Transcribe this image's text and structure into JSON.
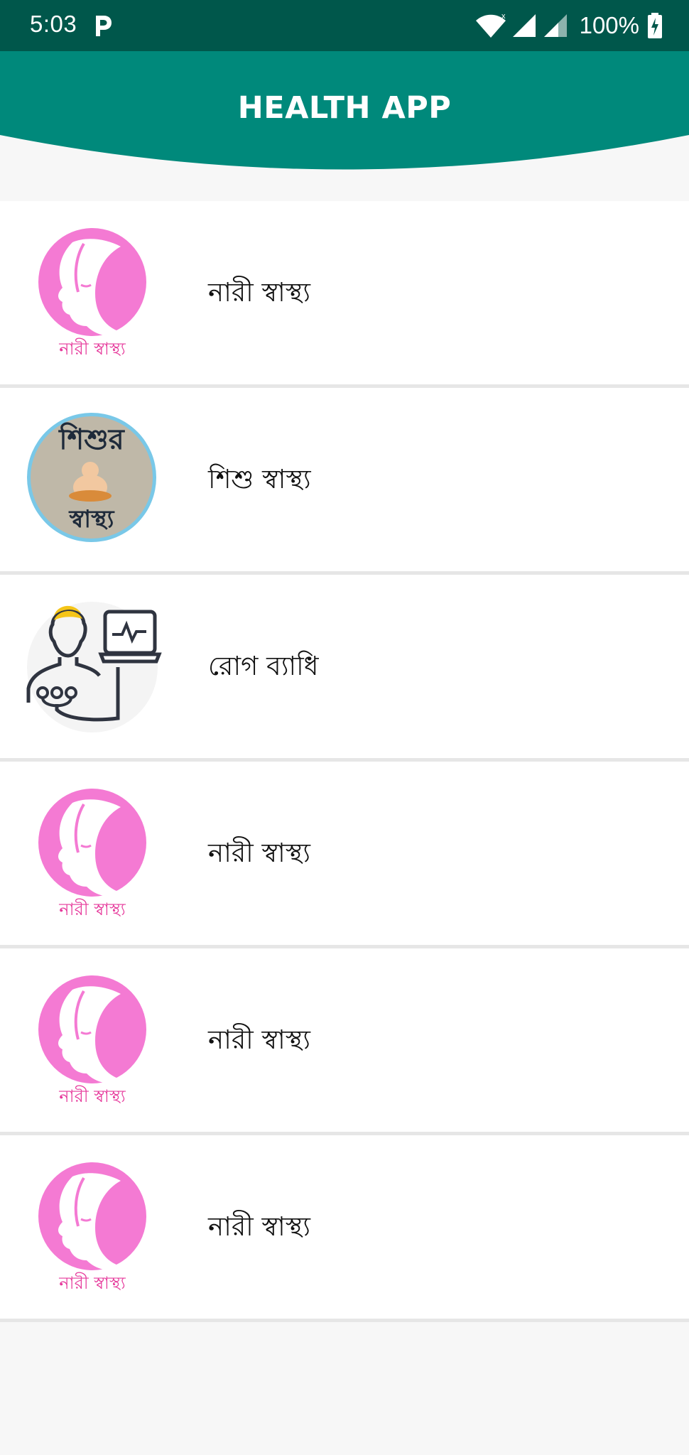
{
  "status_bar": {
    "time": "5:03",
    "battery": "100%",
    "icons": [
      "parking-app-icon",
      "wifi-icon",
      "cell-signal-icon",
      "cell-signal-icon",
      "battery-charging-icon"
    ],
    "background": "#00574b"
  },
  "header": {
    "title": "HEALTH APP",
    "color": "#00897b"
  },
  "list": {
    "items": [
      {
        "label": "নারী স্বাস্থ্য",
        "icon": "woman-face-icon",
        "icon_caption": "নারী স্বাস্থ্য"
      },
      {
        "label": "শিশু স্বাস্থ্য",
        "icon": "baby-health-icon",
        "icon_caption_top": "শিশুর",
        "icon_caption_bottom": "স্বাস্থ্য"
      },
      {
        "label": "রোগ ব্যাধি",
        "icon": "patient-monitor-icon"
      },
      {
        "label": "নারী স্বাস্থ্য",
        "icon": "woman-face-icon",
        "icon_caption": "নারী স্বাস্থ্য"
      },
      {
        "label": "নারী স্বাস্থ্য",
        "icon": "woman-face-icon",
        "icon_caption": "নারী স্বাস্থ্য"
      },
      {
        "label": "নারী স্বাস্থ্য",
        "icon": "woman-face-icon",
        "icon_caption": "নারী স্বাস্থ্য"
      }
    ]
  },
  "colors": {
    "pink": "#f47ad3",
    "caption_pink": "#e6399b",
    "teal": "#00897b",
    "baby_bg": "#bfb8a8",
    "baby_ring": "#79c8e8"
  }
}
